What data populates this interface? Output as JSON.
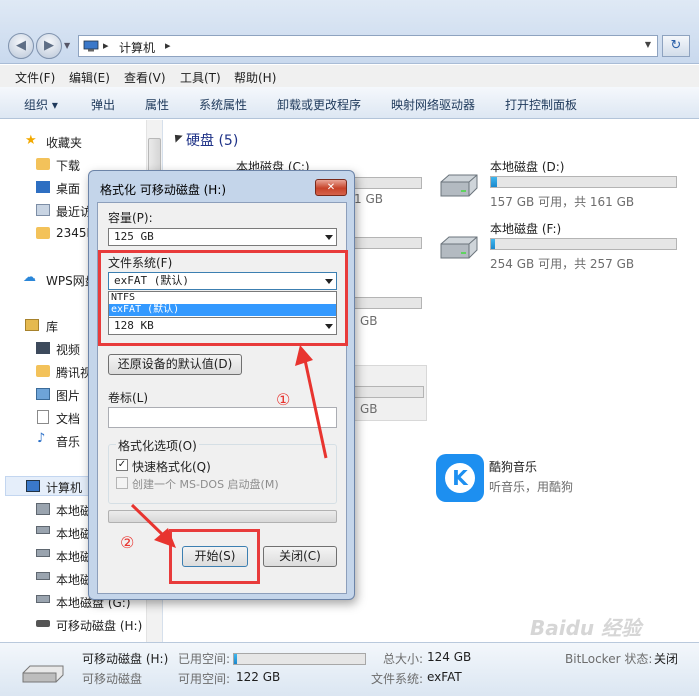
{
  "address": {
    "crumb": "计算机",
    "sep1": "▸",
    "sep2": "▸"
  },
  "menu": [
    "文件(F)",
    "编辑(E)",
    "查看(V)",
    "工具(T)",
    "帮助(H)"
  ],
  "toolbar": [
    "组织 ▾",
    "弹出",
    "属性",
    "系统属性",
    "卸载或更改程序",
    "映射网络驱动器",
    "打开控制面板"
  ],
  "sidebar": {
    "favorites": "收藏夹",
    "fav_items": [
      "下载",
      "桌面",
      "最近访",
      "2345D"
    ],
    "wps": "WPS网盘",
    "library": "库",
    "lib_items": [
      "视频",
      "腾讯视",
      "图片",
      "文档",
      "音乐"
    ],
    "computer": "计算机",
    "computer_items": [
      "本地磁",
      "本地磁",
      "本地磁",
      "本地磁",
      "本地磁盘 (G:)",
      "可移动磁盘 (H:)"
    ]
  },
  "main": {
    "group_title": "硬盘 (5)",
    "drives": [
      {
        "name": "本地磁盘 (C:)",
        "info_fragment": "1 GB"
      },
      {
        "name": "本地磁盘 (D:)",
        "info": "157 GB 可用，共 161 GB",
        "used_fraction": 0.03
      },
      {
        "name": "本地磁盘 (F:)",
        "info": "254 GB 可用，共 257 GB",
        "used_fraction": 0.02
      }
    ],
    "fragments": [
      "GB",
      "GB"
    ],
    "kugou": {
      "name": "酷狗音乐",
      "desc": "听音乐，用酷狗",
      "glyph": "K"
    }
  },
  "dialog": {
    "title": "格式化 可移动磁盘 (H:)",
    "close_glyph": "✕",
    "capacity_label": "容量(P):",
    "capacity_value": "125 GB",
    "fs_label": "文件系统(F)",
    "fs_value": "exFAT (默认)",
    "fs_options": [
      "NTFS",
      "exFAT (默认)"
    ],
    "alloc_value": "128 KB",
    "restore_button": "还原设备的默认值(D)",
    "volume_label": "卷标(L)",
    "format_options_label": "格式化选项(O)",
    "quick_format": "快速格式化(Q)",
    "msdos_disk": "创建一个 MS-DOS 启动盘(M)",
    "start_button": "开始(S)",
    "close_button": "关闭(C)"
  },
  "annotations": {
    "step1": "①",
    "step2": "②"
  },
  "status": {
    "drive_name": "可移动磁盘 (H:)",
    "drive_type": "可移动磁盘",
    "used_label": "已用空间:",
    "free_label": "可用空间:",
    "free_value": "122 GB",
    "total_label": "总大小:",
    "total_value": "124 GB",
    "fs_label": "文件系统:",
    "fs_value": "exFAT",
    "bitlocker_label": "BitLocker 状态:",
    "bitlocker_value": "关闭",
    "used_fraction": 0.02
  },
  "watermark": "Baidu 经验"
}
